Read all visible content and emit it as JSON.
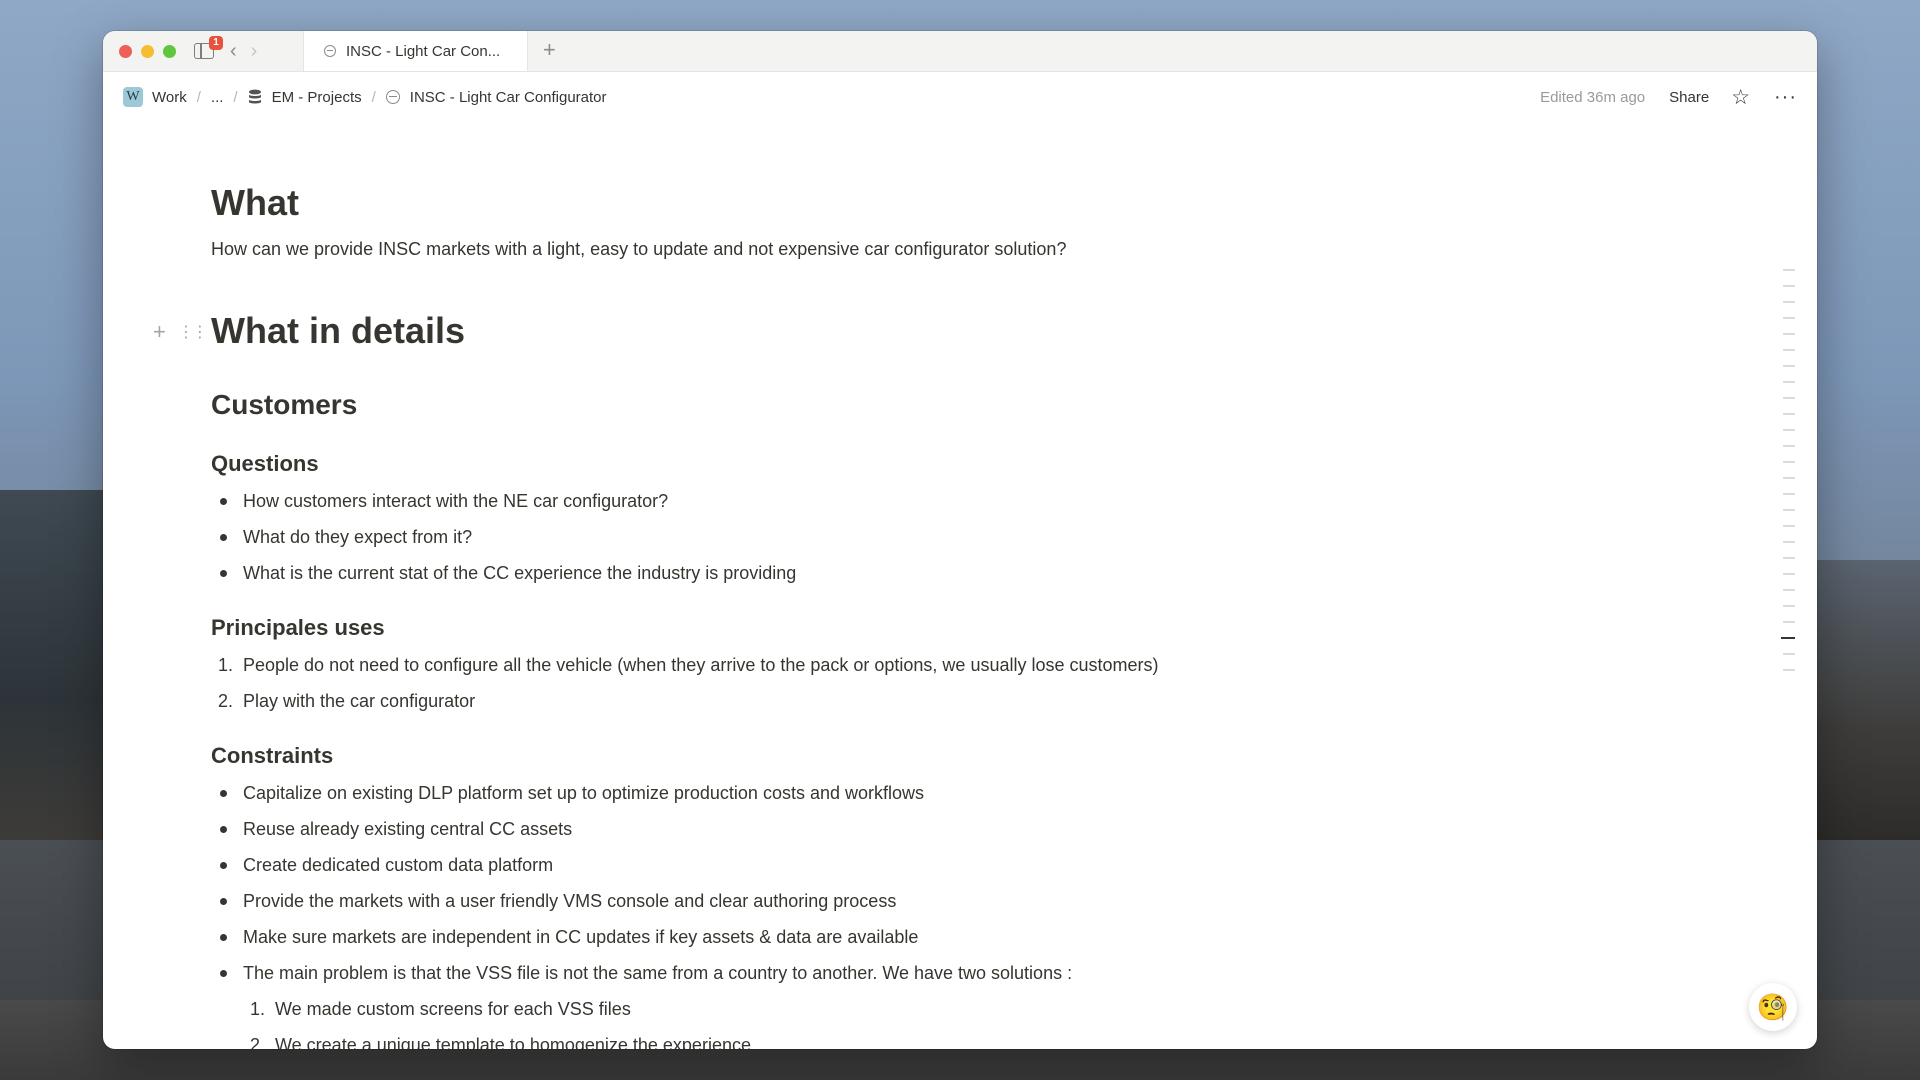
{
  "titlebar": {
    "badge_count": "1",
    "tab_title": "INSC - Light Car Con...",
    "new_tab": "+",
    "back": "‹",
    "forward": "›"
  },
  "breadcrumb": {
    "workspace_icon": "W",
    "workspace": "Work",
    "ellipsis": "...",
    "database": "EM - Projects",
    "page": "INSC - Light Car Configurator",
    "separator": "/"
  },
  "actions": {
    "edited": "Edited 36m ago",
    "share": "Share",
    "star": "☆",
    "more": "···"
  },
  "doc": {
    "what_heading": "What",
    "what_text": "How can we provide INSC markets with a light, easy to update and not expensive car configurator solution?",
    "details_heading": "What in details",
    "customers_heading": "Customers",
    "questions_heading": "Questions",
    "questions": [
      "How customers interact with the NE car configurator?",
      "What do they expect from it?",
      "What is the current stat of the CC experience the industry is providing"
    ],
    "uses_heading": "Principales uses",
    "uses": [
      "People do not need to configure all the vehicle (when they arrive to the pack or options, we usually lose customers)",
      "Play with the car configurator"
    ],
    "constraints_heading": "Constraints",
    "constraints": [
      "Capitalize on existing DLP platform set up to optimize production costs and workflows",
      "Reuse already existing central CC assets",
      "Create dedicated custom data platform",
      "Provide the markets with a user friendly VMS console and clear authoring process",
      "Make sure markets are independent in CC updates if key assets & data are available",
      "The main problem is that the VSS file is not the same from a country to another. We have two solutions :"
    ],
    "solutions": [
      "We made custom screens for each VSS files",
      "We create a unique template to homogenize the experience"
    ],
    "num1": "1.",
    "num2": "2."
  },
  "icons": {
    "plus": "+",
    "grip": "⋮⋮",
    "help": "🧐"
  }
}
